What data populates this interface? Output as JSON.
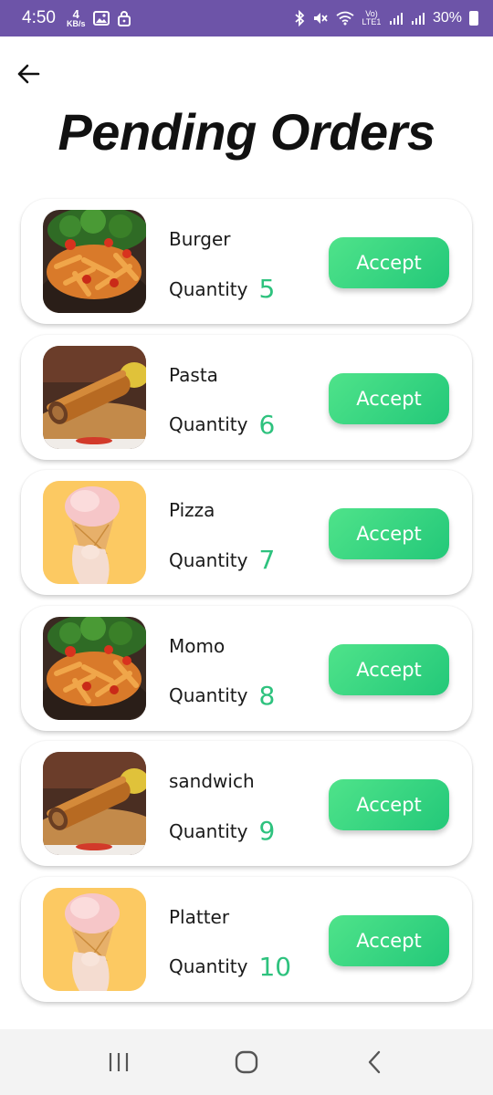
{
  "status_bar": {
    "time": "4:50",
    "speed_value": "4",
    "speed_unit": "KB/s",
    "network_label": "Vo) LTE1",
    "battery": "30%"
  },
  "header": {
    "title": "Pending Orders",
    "back_icon": "arrow-left-icon"
  },
  "orders": [
    {
      "name": "Burger",
      "quantity_label": "Quantity",
      "quantity": "5",
      "action": "Accept",
      "image": "pasta-dish"
    },
    {
      "name": "Pasta",
      "quantity_label": "Quantity",
      "quantity": "6",
      "action": "Accept",
      "image": "wraps-dish"
    },
    {
      "name": "Pizza",
      "quantity_label": "Quantity",
      "quantity": "7",
      "action": "Accept",
      "image": "ice-cream"
    },
    {
      "name": "Momo",
      "quantity_label": "Quantity",
      "quantity": "8",
      "action": "Accept",
      "image": "pasta-dish"
    },
    {
      "name": "sandwich",
      "quantity_label": "Quantity",
      "quantity": "9",
      "action": "Accept",
      "image": "wraps-dish"
    },
    {
      "name": "Platter",
      "quantity_label": "Quantity",
      "quantity": "10",
      "action": "Accept",
      "image": "ice-cream"
    }
  ],
  "nav": {
    "recents_icon": "recents-icon",
    "home_icon": "home-icon",
    "back_icon": "back-chevron-icon"
  },
  "colors": {
    "status_bar": "#6d54a8",
    "accent_green": "#2ec27e",
    "button_start": "#4fe38a",
    "button_end": "#23c879"
  }
}
